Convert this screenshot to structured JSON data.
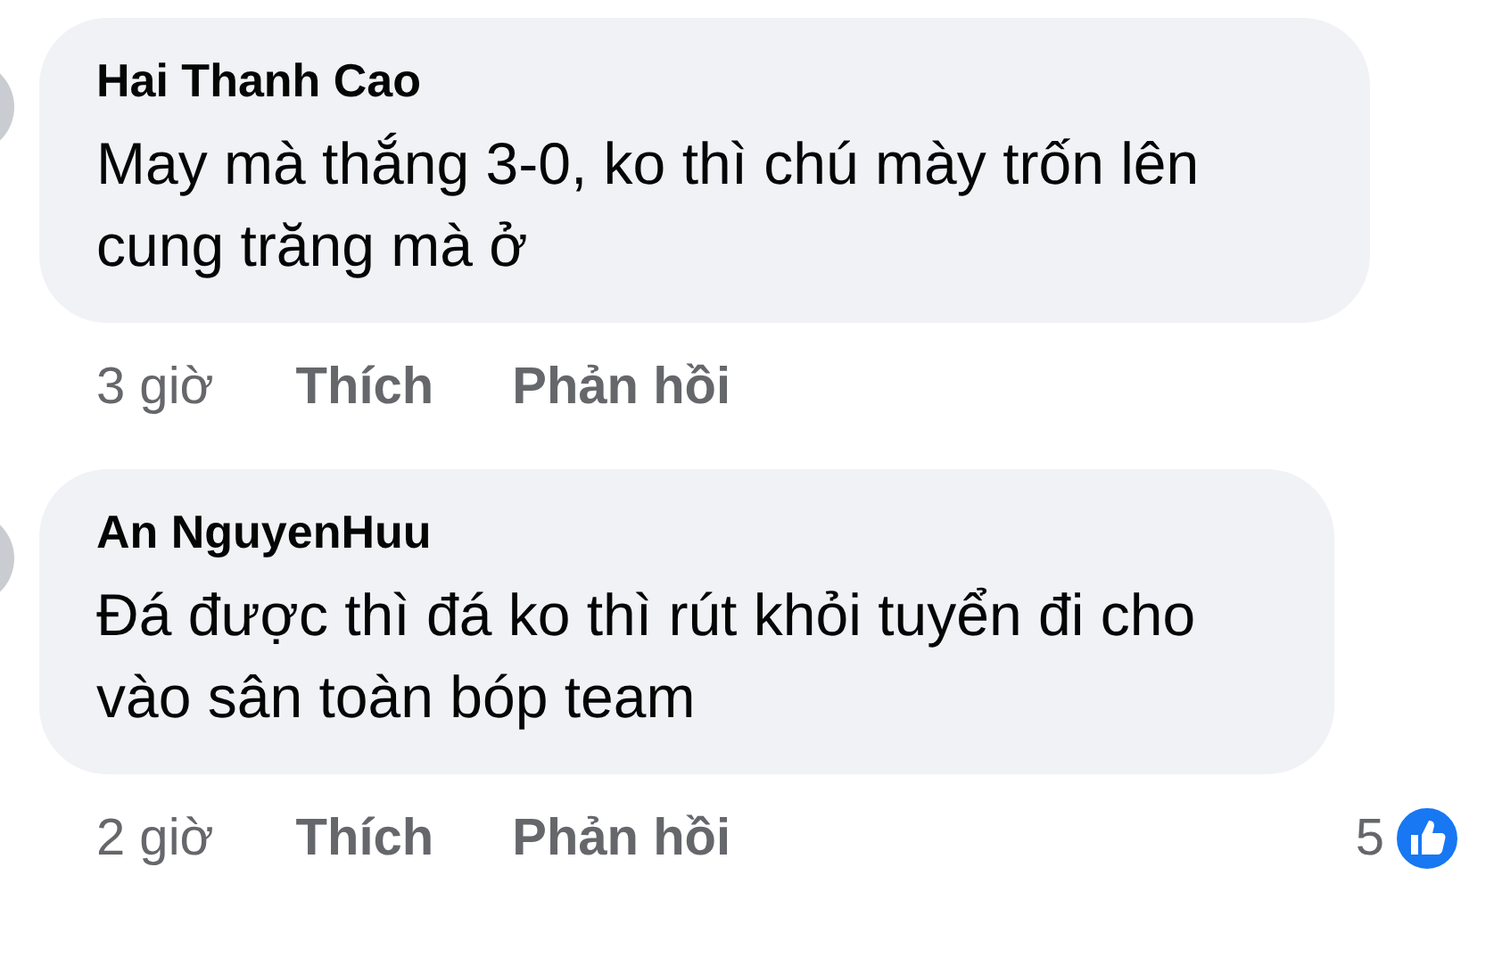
{
  "comments": [
    {
      "author": "Hai Thanh Cao",
      "text": "May mà thắng 3-0, ko thì chú mày trốn lên cung trăng mà ở",
      "time": "3 giờ",
      "like": "Thích",
      "reply": "Phản hồi"
    },
    {
      "author": "An NguyenHuu",
      "text": "Đá được thì đá ko thì rút khỏi tuyển đi cho vào sân toàn bóp team",
      "time": "2 giờ",
      "like": "Thích",
      "reply": "Phản hồi",
      "reaction_count": "5"
    }
  ]
}
